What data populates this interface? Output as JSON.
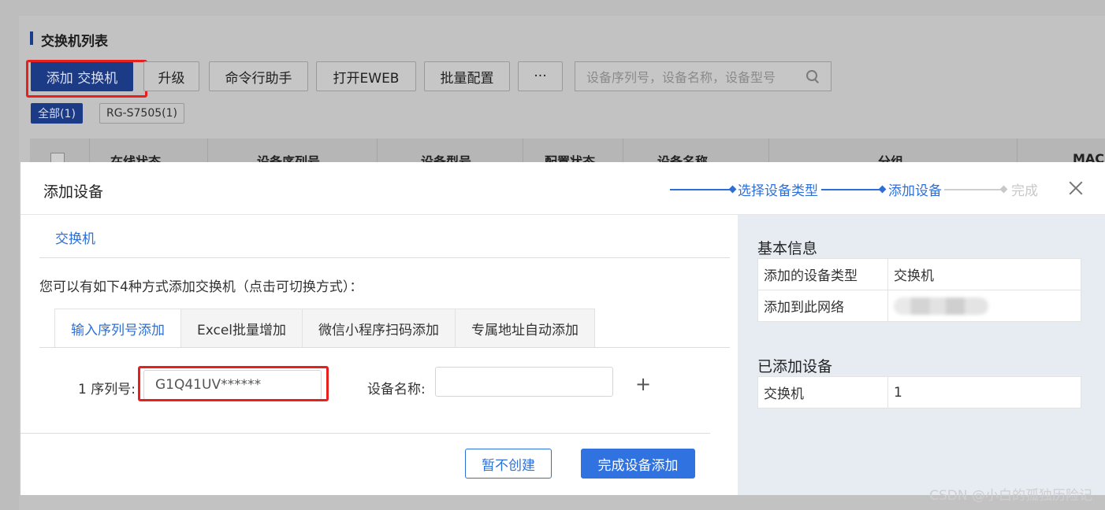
{
  "background": {
    "title": "交换机列表",
    "toolbar": {
      "add_switch": "添加 交换机",
      "upgrade": "升级",
      "cmd_helper": "命令行助手",
      "open_eweb": "打开EWEB",
      "batch_config": "批量配置",
      "more": "···"
    },
    "search": {
      "placeholder": "设备序列号，设备名称，设备型号"
    },
    "filter_tags": {
      "all": "全部(1)",
      "model": "RG-S7505(1)"
    },
    "table_headers": [
      "在线状态",
      "设备序列号",
      "设备型号",
      "配置状态",
      "设备名称",
      "分组",
      "MAC"
    ]
  },
  "modal": {
    "title": "添加设备",
    "steps": [
      "选择设备类型",
      "添加设备",
      "完成"
    ],
    "current_step": 2,
    "device_type_tab": "交换机",
    "hint": "您可以有如下4种方式添加交换机（点击可切换方式）：",
    "method_tabs": [
      "输入序列号添加",
      "Excel批量增加",
      "微信小程序扫码添加",
      "专属地址自动添加"
    ],
    "active_method": 0,
    "form": {
      "serial_label": "1 序列号:",
      "serial_value": "G1Q41UV******",
      "name_label": "设备名称:",
      "name_value": "",
      "add_row": "+"
    },
    "buttons": {
      "skip": "暂不创建",
      "finish": "完成设备添加"
    },
    "summary": {
      "basic_title": "基本信息",
      "basic_rows": [
        {
          "k": "添加的设备类型",
          "v": "交换机"
        },
        {
          "k": "添加到此网络",
          "v": ""
        }
      ],
      "added_title": "已添加设备",
      "added_rows": [
        {
          "k": "交换机",
          "v": "1"
        }
      ]
    }
  },
  "watermark": "CSDN @小白的孤独历险记",
  "colors": {
    "accent": "#2f72e0",
    "highlight": "#e8201d",
    "step_done": "#2d6fd8",
    "step_todo": "#c8c8c8"
  }
}
